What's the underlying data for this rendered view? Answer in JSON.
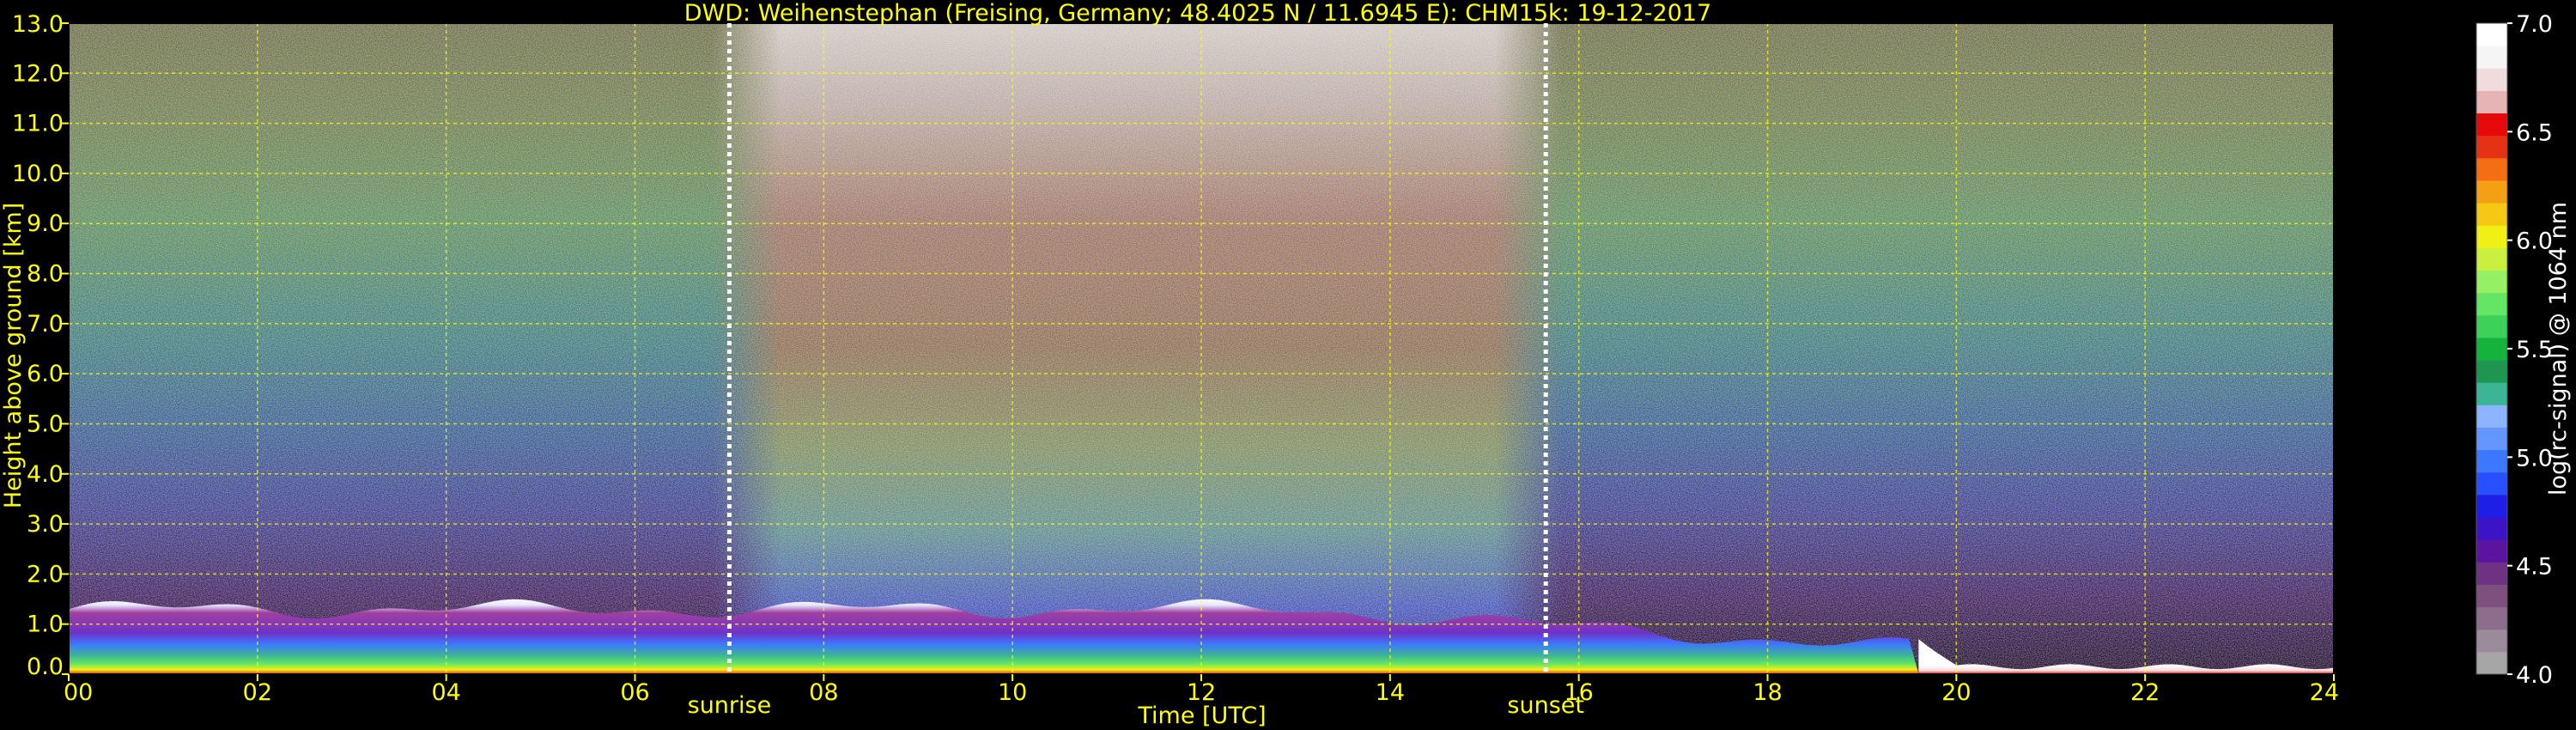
{
  "chart_data": {
    "type": "heatmap",
    "title": "DWD: Weihenstephan (Freising, Germany; 48.4025 N / 11.6945 E):    CHM15k: 19-12-2017",
    "xlabel": "Time [UTC]",
    "ylabel": "Height above ground [km]",
    "xlim": [
      0,
      24
    ],
    "ylim": [
      0,
      13
    ],
    "x_ticks": [
      {
        "value": 0,
        "label": "00"
      },
      {
        "value": 2,
        "label": "02"
      },
      {
        "value": 4,
        "label": "04"
      },
      {
        "value": 6,
        "label": "06"
      },
      {
        "value": 8,
        "label": "08"
      },
      {
        "value": 10,
        "label": "10"
      },
      {
        "value": 12,
        "label": "12"
      },
      {
        "value": 14,
        "label": "14"
      },
      {
        "value": 16,
        "label": "16"
      },
      {
        "value": 18,
        "label": "18"
      },
      {
        "value": 20,
        "label": "20"
      },
      {
        "value": 22,
        "label": "22"
      },
      {
        "value": 24,
        "label": "24"
      }
    ],
    "y_ticks": [
      {
        "value": 0,
        "label": "0.0"
      },
      {
        "value": 1,
        "label": "1.0"
      },
      {
        "value": 2,
        "label": "2.0"
      },
      {
        "value": 3,
        "label": "3.0"
      },
      {
        "value": 4,
        "label": "4.0"
      },
      {
        "value": 5,
        "label": "5.0"
      },
      {
        "value": 6,
        "label": "6.0"
      },
      {
        "value": 7,
        "label": "7.0"
      },
      {
        "value": 8,
        "label": "8.0"
      },
      {
        "value": 9,
        "label": "9.0"
      },
      {
        "value": 10,
        "label": "10.0"
      },
      {
        "value": 11,
        "label": "11.0"
      },
      {
        "value": 12,
        "label": "12.0"
      },
      {
        "value": 13,
        "label": "13.0"
      }
    ],
    "grid": true,
    "grid_color": "#ffff00",
    "text_color": "#ffff00",
    "markers": [
      {
        "label": "sunrise",
        "time": 7.0
      },
      {
        "label": "sunset",
        "time": 15.65
      }
    ],
    "colorbar": {
      "label": "log(rc-signal) @ 1064 nm",
      "range": [
        4.0,
        7.0
      ],
      "ticks": [
        {
          "value": 4.0,
          "label": "4.0"
        },
        {
          "value": 4.5,
          "label": "4.5"
        },
        {
          "value": 5.0,
          "label": "5.0"
        },
        {
          "value": 5.5,
          "label": "5.5"
        },
        {
          "value": 6.0,
          "label": "6.0"
        },
        {
          "value": 6.5,
          "label": "6.5"
        },
        {
          "value": 7.0,
          "label": "7.0"
        }
      ],
      "colors": [
        "#a6a6a6",
        "#9a8a9a",
        "#8c6e8c",
        "#7e507e",
        "#6e3282",
        "#5a14a0",
        "#3c14c8",
        "#1e1ee6",
        "#2850ff",
        "#3c78ff",
        "#6496ff",
        "#8cb4ff",
        "#3cb496",
        "#1e9650",
        "#14b43c",
        "#3cd25a",
        "#64e664",
        "#96f064",
        "#c8f03c",
        "#f0f014",
        "#f5c814",
        "#f5a014",
        "#f56e14",
        "#e63214",
        "#e60a0a",
        "#e6b4b4",
        "#f0dcdc",
        "#f5f5f5",
        "#ffffff"
      ]
    },
    "signal_summary": {
      "boundary_layer_top_km": 1.3,
      "boundary_layer_top_after_19h_km": 0.15,
      "dense_lowlevel_fog_from_utc": 19.6,
      "daylight_background_high": true
    }
  }
}
